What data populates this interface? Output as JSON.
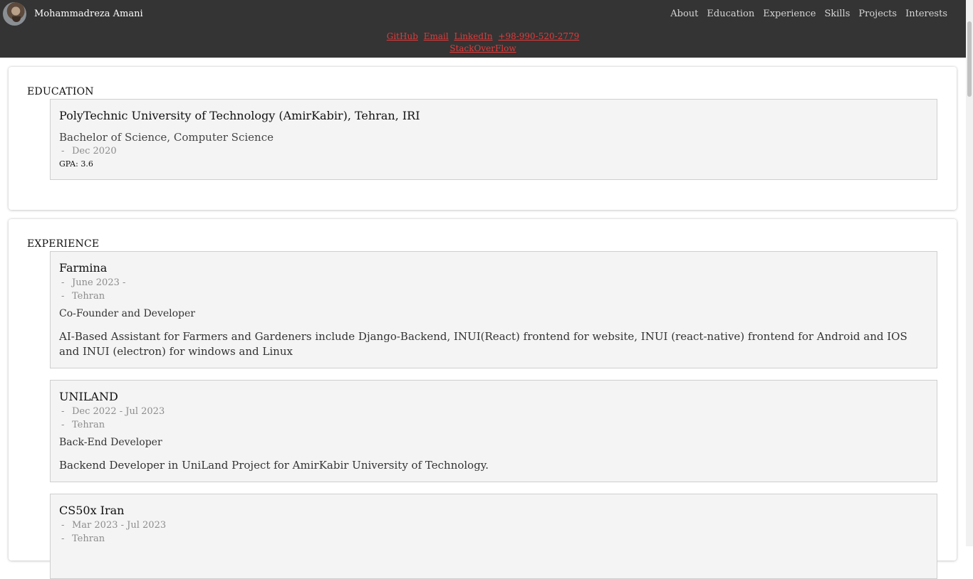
{
  "header": {
    "name": "Mohammadreza Amani",
    "nav": [
      "About",
      "Education",
      "Experience",
      "Skills",
      "Projects",
      "Interests"
    ],
    "contacts": [
      "GitHub",
      "Email",
      "LinkedIn",
      "+98-990-520-2779",
      "StackOverFlow"
    ]
  },
  "education": {
    "heading": "EDUCATION",
    "items": [
      {
        "school": "PolyTechnic University of Technology (AmirKabir), Tehran, IRI",
        "degree": "Bachelor of Science, Computer Science",
        "date": "Dec 2020",
        "gpa": "GPA: 3.6"
      }
    ]
  },
  "experience": {
    "heading": "EXPERIENCE",
    "items": [
      {
        "company": "Farmina",
        "date": "June 2023 -",
        "location": "Tehran",
        "role": "Co-Founder and Developer",
        "description": "AI-Based Assistant for Farmers and Gardeners include Django-Backend, INUI(React) frontend for website, INUI (react-native) frontend for Android and IOS and INUI (electron) for windows and Linux"
      },
      {
        "company": "UNILAND",
        "date": "Dec 2022 - Jul 2023",
        "location": "Tehran",
        "role": "Back-End Developer",
        "description": "Backend Developer in UniLand Project for AmirKabir University of Technology."
      },
      {
        "company": "CS50x Iran",
        "date": "Mar 2023 - Jul 2023",
        "location": "Tehran"
      }
    ]
  },
  "meta_dash": "-"
}
